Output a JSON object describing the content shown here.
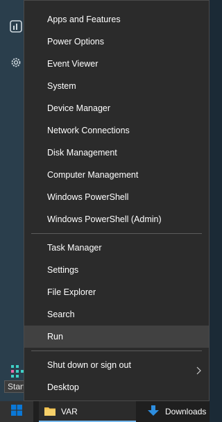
{
  "menu": {
    "items": [
      {
        "label": "Apps and Features"
      },
      {
        "label": "Power Options"
      },
      {
        "label": "Event Viewer"
      },
      {
        "label": "System"
      },
      {
        "label": "Device Manager"
      },
      {
        "label": "Network Connections"
      },
      {
        "label": "Disk Management"
      },
      {
        "label": "Computer Management"
      },
      {
        "label": "Windows PowerShell"
      },
      {
        "label": "Windows PowerShell (Admin)"
      },
      {
        "label": "Task Manager"
      },
      {
        "label": "Settings"
      },
      {
        "label": "File Explorer"
      },
      {
        "label": "Search"
      },
      {
        "label": "Run"
      },
      {
        "label": "Shut down or sign out"
      },
      {
        "label": "Desktop"
      }
    ]
  },
  "taskbar": {
    "start_tooltip": "Start",
    "apps": [
      {
        "label": "VAR",
        "icon": "folder-icon"
      },
      {
        "label": "Downloads",
        "icon": "download-icon"
      }
    ]
  },
  "colors": {
    "menu_bg": "#2b2b2b",
    "hover_bg": "#414141",
    "accent": "#0a78d7",
    "taskbar_bg": "#1f1f1f"
  }
}
